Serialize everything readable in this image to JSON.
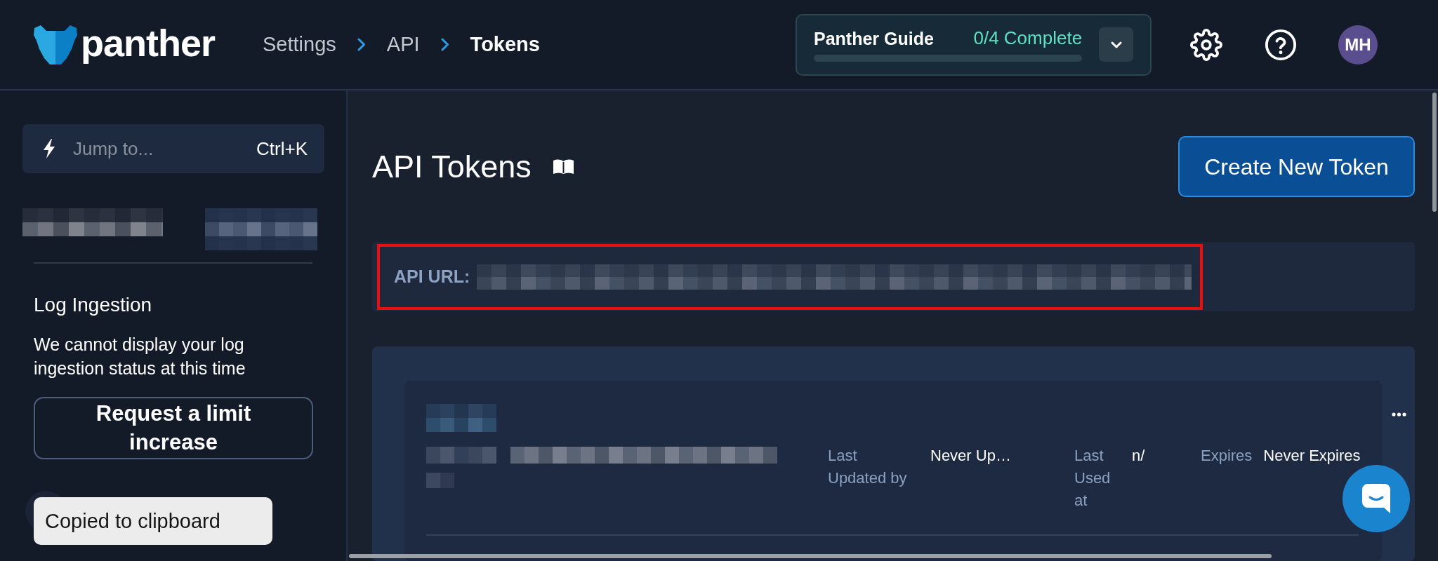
{
  "header": {
    "logo": {
      "text": "panther"
    },
    "breadcrumbs": [
      {
        "label": "Settings",
        "current": false
      },
      {
        "label": "API",
        "current": false
      },
      {
        "label": "Tokens",
        "current": true
      }
    ],
    "guide": {
      "title": "Panther Guide",
      "status": "0/4 Complete",
      "level": 0
    },
    "avatar": {
      "initials": "MH"
    }
  },
  "sidebar": {
    "search": {
      "placeholder": "Jump to...",
      "shortcut": "Ctrl+K"
    },
    "log_ingestion": {
      "title": "Log Ingestion",
      "message": "We cannot display your log ingestion status at this time",
      "button": "Request a limit increase"
    }
  },
  "main": {
    "title": "API Tokens",
    "create_button": "Create New Token",
    "api_url": {
      "label": "API URL:",
      "highlighted": true
    },
    "tokens": [
      {
        "fields": [
          {
            "label": "Last Updated by",
            "value": "Never Up…"
          },
          {
            "label": "Last Used at",
            "value": "n/"
          },
          {
            "label": "Expires",
            "value": "Never Expires"
          }
        ]
      }
    ]
  },
  "toast": {
    "message": "Copied to clipboard"
  }
}
